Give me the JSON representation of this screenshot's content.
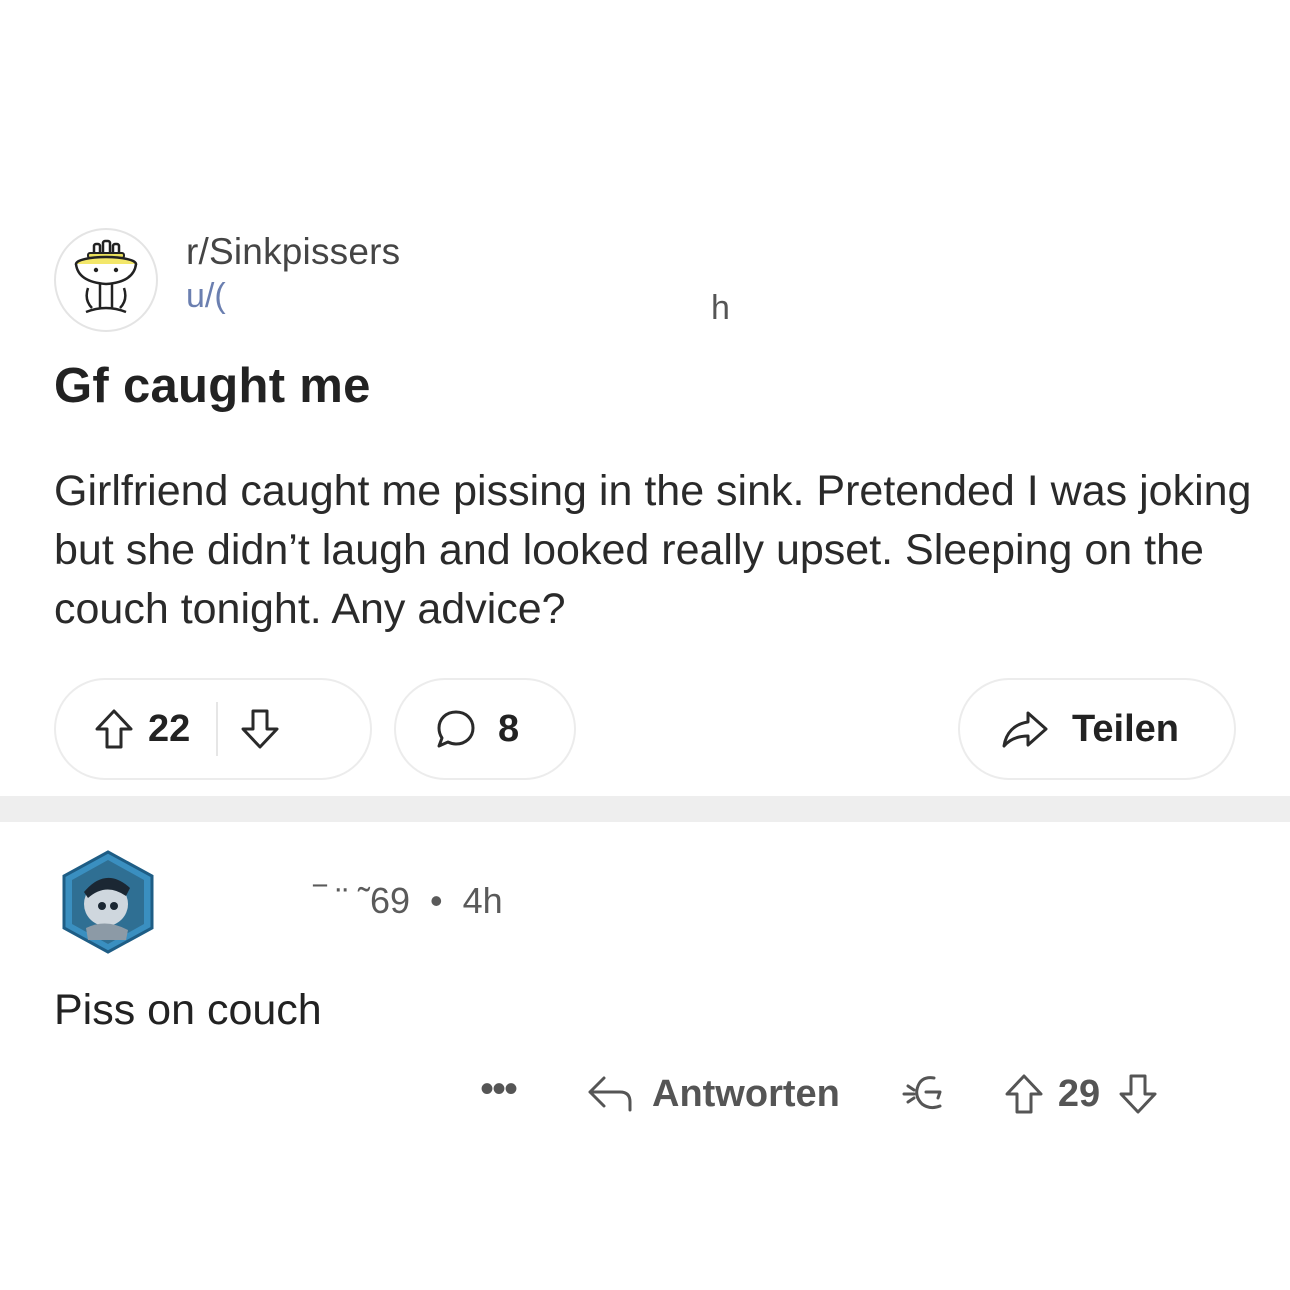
{
  "post": {
    "subreddit": "r/Sinkpissers",
    "user": "u/(",
    "age": "h",
    "title": "Gf caught me",
    "body": "Girlfriend caught me pissing in the sink. Pretended I was joking but she didn’t laugh and looked really upset. Sleeping on the couch tonight. Any advice?",
    "score": "22",
    "comment_count": "8",
    "share_label": "Teilen"
  },
  "comment": {
    "username": "‾ ¨ ˜69",
    "dot": "•",
    "age": "4h",
    "body": "Piss on couch",
    "more": "•••",
    "reply_label": "Antworten",
    "score": "29"
  },
  "icons": {
    "subreddit_avatar": "sink-icon",
    "upvote": "arrow-up-icon",
    "downvote": "arrow-down-icon",
    "comment": "speech-bubble-icon",
    "share": "share-arrow-icon",
    "reply": "reply-arrow-icon",
    "award": "award-icon"
  },
  "colors": {
    "background": "#ffffff",
    "username_link": "#6b7fb0",
    "separator": "#eeeeee",
    "pill_border": "#ececec"
  }
}
